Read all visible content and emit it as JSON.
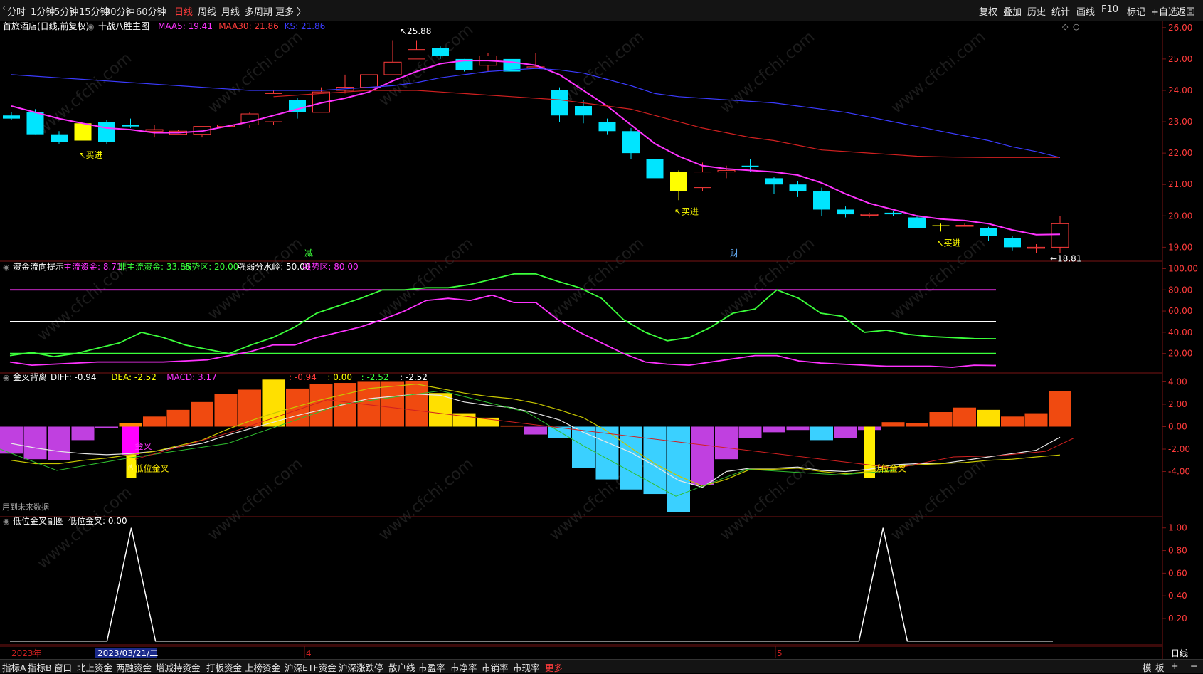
{
  "topbar": {
    "periods": [
      "分时",
      "1分钟",
      "5分钟",
      "15分钟",
      "30分钟",
      "60分钟",
      "日线",
      "周线",
      "月线",
      "多周期",
      "更多 〉"
    ],
    "active_period": "日线",
    "right_buttons": [
      "复权",
      "叠加",
      "历史",
      "统计",
      "画线",
      "F10",
      "标记",
      "+自选",
      "返回"
    ]
  },
  "main_panel": {
    "stock_label": "首旅酒店(日线,前复权)",
    "indicator_name": "十战八胜主图",
    "legend": [
      {
        "text": "MAA5: 19.41",
        "color": "#ff33ff"
      },
      {
        "text": "MAA30: 21.86",
        "color": "#ff3b3b"
      },
      {
        "text": "KS: 21.86",
        "color": "#3b3bff"
      }
    ],
    "y_ticks": [
      "26.00",
      "25.00",
      "24.00",
      "23.00",
      "22.00",
      "21.00",
      "20.00",
      "19.00"
    ],
    "y_range": [
      18.6,
      26.2
    ],
    "high_label": "25.88",
    "low_label": "←18.81",
    "buy_label": "↖买进",
    "markers": [
      {
        "text": "减",
        "color": "#3bff3b"
      },
      {
        "text": "财",
        "color": "#66b3ff"
      }
    ]
  },
  "flow_panel": {
    "title": "资金流向提示",
    "legend": [
      {
        "text": "主流资金: 8.71",
        "color": "#ff33ff"
      },
      {
        "text": "非主流资金: 33.85",
        "color": "#3bff3b"
      },
      {
        "text": "弱势区: 20.00",
        "color": "#3bff3b"
      },
      {
        "text": "强弱分水岭: 50.00",
        "color": "#ffffff"
      },
      {
        "text": "强势区: 80.00",
        "color": "#ff33ff"
      }
    ],
    "y_ticks": [
      "100.00",
      "80.00",
      "60.00",
      "40.00",
      "20.00"
    ],
    "y_range": [
      3,
      105
    ]
  },
  "macd_panel": {
    "title": "金叉背离",
    "legend": [
      {
        "text": "DIFF: -0.94",
        "color": "#ffffff"
      },
      {
        "text": "DEA: -2.52",
        "color": "#ffff00"
      },
      {
        "text": "MACD: 3.17",
        "color": "#ff33ff"
      }
    ],
    "legend2": [
      {
        "text": ": -0.94",
        "color": "#ff3b3b"
      },
      {
        "text": ": 0.00",
        "color": "#ffff00"
      },
      {
        "text": ": -2.52",
        "color": "#3bff3b"
      },
      {
        "text": ": -2.52",
        "color": "#ffffff"
      }
    ],
    "y_ticks": [
      "4.00",
      "2.00",
      "0.00",
      "-2.00",
      "-4.00"
    ],
    "y_range": [
      -7.9,
      4.6
    ],
    "cross_label": "低位金叉",
    "cross_label_purple": "金叉",
    "future_note": "用到未来数据"
  },
  "signal_panel": {
    "title": "低位金叉副图",
    "legend": [
      {
        "text": "低位金叉: 0.00",
        "color": "#ffffff"
      }
    ],
    "y_ticks": [
      "1.00",
      "0.80",
      "0.60",
      "0.40",
      "0.20"
    ],
    "y_range": [
      -0.02,
      1.08
    ]
  },
  "axis": {
    "year_label": "2023年",
    "date_tag": "2023/03/21/二",
    "month_labels": [
      "4",
      "5"
    ]
  },
  "statusbar": {
    "tabs": [
      "指标A",
      "指标B",
      "窗口",
      "北上资金",
      "两融资金",
      "增减持资金",
      "打板资金",
      "上榜资金",
      "沪深ETF资金",
      "沪深涨跌停",
      "散户线",
      "市盈率",
      "市净率",
      "市销率",
      "市现率",
      "更多"
    ],
    "right_tabs": [
      "模",
      "板"
    ],
    "period": "日线"
  },
  "watermark": "www.cfchi.com",
  "chart_data": [
    {
      "type": "candlestick",
      "title": "首旅酒店(日线,前复权)",
      "ohlc": [
        [
          23.2,
          23.3,
          23.05,
          23.1
        ],
        [
          23.3,
          23.4,
          22.6,
          22.6
        ],
        [
          22.6,
          22.7,
          22.3,
          22.35
        ],
        [
          22.4,
          23.0,
          22.3,
          22.95
        ],
        [
          23.0,
          23.05,
          22.3,
          22.35
        ],
        [
          22.9,
          23.1,
          22.8,
          22.85
        ],
        [
          22.7,
          22.9,
          22.5,
          22.75
        ],
        [
          22.6,
          22.75,
          22.6,
          22.7
        ],
        [
          22.6,
          22.85,
          22.5,
          22.85
        ],
        [
          22.85,
          23.0,
          22.7,
          22.9
        ],
        [
          22.9,
          23.3,
          22.8,
          23.25
        ],
        [
          23.0,
          24.0,
          22.9,
          23.9
        ],
        [
          23.7,
          23.75,
          23.1,
          23.3
        ],
        [
          23.3,
          24.1,
          23.3,
          23.95
        ],
        [
          24.0,
          24.5,
          23.9,
          24.1
        ],
        [
          24.1,
          24.9,
          24.1,
          24.5
        ],
        [
          24.5,
          25.6,
          24.5,
          24.9
        ],
        [
          25.0,
          25.6,
          25.0,
          25.3
        ],
        [
          25.35,
          25.4,
          25.0,
          25.1
        ],
        [
          25.0,
          25.0,
          24.6,
          24.65
        ],
        [
          24.8,
          25.2,
          24.6,
          25.1
        ],
        [
          25.0,
          25.1,
          24.55,
          24.6
        ],
        [
          24.75,
          25.2,
          24.7,
          24.75
        ],
        [
          24.0,
          24.1,
          23.0,
          23.2
        ],
        [
          23.5,
          23.7,
          22.95,
          23.2
        ],
        [
          23.0,
          23.1,
          22.6,
          22.7
        ],
        [
          22.7,
          22.8,
          21.8,
          22.0
        ],
        [
          21.8,
          21.9,
          21.2,
          21.2
        ],
        [
          21.4,
          21.45,
          20.5,
          20.8
        ],
        [
          20.9,
          21.7,
          20.8,
          21.4
        ],
        [
          21.4,
          21.6,
          21.2,
          21.45
        ],
        [
          21.6,
          21.8,
          21.4,
          21.55
        ],
        [
          21.2,
          21.25,
          20.7,
          21.0
        ],
        [
          21.0,
          21.1,
          20.6,
          20.8
        ],
        [
          20.8,
          20.9,
          20.0,
          20.2
        ],
        [
          20.2,
          20.3,
          19.95,
          20.05
        ],
        [
          20.05,
          20.1,
          19.95,
          20.05
        ],
        [
          20.1,
          20.15,
          20.0,
          20.05
        ],
        [
          19.95,
          20.0,
          19.6,
          19.6
        ],
        [
          19.7,
          19.75,
          19.5,
          19.7
        ],
        [
          19.7,
          19.75,
          19.7,
          19.7
        ],
        [
          19.6,
          19.65,
          19.2,
          19.35
        ],
        [
          19.3,
          19.35,
          18.9,
          19.0
        ],
        [
          19.0,
          19.1,
          18.81,
          19.0
        ],
        [
          19.0,
          20.0,
          18.81,
          19.75
        ]
      ],
      "series": [
        {
          "name": "MAA5",
          "values": [
            23.5,
            23.3,
            23.1,
            22.95,
            22.8,
            22.75,
            22.65,
            22.65,
            22.7,
            22.85,
            23.0,
            23.2,
            23.4,
            23.6,
            23.75,
            23.95,
            24.3,
            24.6,
            24.85,
            24.95,
            24.95,
            24.9,
            24.8,
            24.5,
            24.0,
            23.5,
            22.9,
            22.3,
            21.9,
            21.6,
            21.5,
            21.45,
            21.4,
            21.3,
            21.05,
            20.7,
            20.4,
            20.2,
            20.0,
            19.9,
            19.85,
            19.75,
            19.55,
            19.4,
            19.41
          ]
        },
        {
          "name": "MAA30",
          "values": [
            null,
            null,
            null,
            null,
            null,
            null,
            null,
            null,
            null,
            null,
            null,
            23.8,
            23.85,
            23.9,
            23.95,
            24.0,
            24.0,
            24.0,
            23.95,
            23.9,
            23.85,
            23.8,
            23.75,
            23.7,
            23.6,
            23.5,
            23.4,
            23.2,
            23.0,
            22.8,
            22.65,
            22.5,
            22.4,
            22.25,
            22.1,
            22.05,
            22.0,
            21.95,
            21.9,
            21.88,
            21.87,
            21.86,
            21.86,
            21.86,
            21.86
          ]
        },
        {
          "name": "KS",
          "values": [
            24.5,
            24.45,
            24.4,
            24.35,
            24.3,
            24.25,
            24.2,
            24.15,
            24.1,
            24.05,
            24.0,
            24.0,
            24.0,
            24.0,
            24.05,
            24.1,
            24.15,
            24.25,
            24.4,
            24.5,
            24.6,
            24.65,
            24.7,
            24.65,
            24.55,
            24.35,
            24.15,
            23.9,
            23.8,
            23.75,
            23.7,
            23.65,
            23.6,
            23.5,
            23.4,
            23.3,
            23.15,
            23.0,
            22.85,
            22.7,
            22.55,
            22.4,
            22.2,
            22.05,
            21.86
          ]
        }
      ]
    },
    {
      "type": "line",
      "title": "资金流向提示",
      "series": [
        {
          "name": "主流资金",
          "values": [
            12,
            9,
            10,
            11,
            12,
            12,
            12,
            12,
            13,
            14,
            18,
            22,
            28,
            28,
            35,
            40,
            45,
            52,
            60,
            70,
            72,
            70,
            75,
            68,
            68,
            52,
            40,
            30,
            20,
            12,
            10,
            9,
            12,
            15,
            18,
            18,
            13,
            11,
            10,
            9,
            8,
            8,
            8,
            7,
            9,
            8.71
          ]
        },
        {
          "name": "非主流资金",
          "values": [
            18,
            21,
            17,
            20,
            25,
            30,
            40,
            35,
            28,
            24,
            20,
            28,
            35,
            45,
            58,
            65,
            72,
            80,
            80,
            82,
            82,
            85,
            90,
            95,
            95,
            88,
            82,
            72,
            52,
            40,
            32,
            35,
            45,
            58,
            62,
            80,
            72,
            58,
            55,
            40,
            42,
            38,
            36,
            35,
            34,
            33.85
          ]
        }
      ],
      "levels": [
        {
          "name": "弱势区",
          "value": 20
        },
        {
          "name": "强弱分水岭",
          "value": 50
        },
        {
          "name": "强势区",
          "value": 80
        }
      ]
    },
    {
      "type": "bar",
      "title": "金叉背离",
      "series": [
        {
          "name": "MACD",
          "values": [
            -2.4,
            -2.9,
            -3.0,
            -1.2,
            -0.1,
            0.3,
            0.9,
            1.5,
            2.2,
            2.9,
            3.3,
            4.2,
            3.4,
            3.8,
            3.9,
            4.0,
            4.0,
            4.1,
            3.0,
            1.2,
            0.8,
            0.1,
            -0.7,
            -1.0,
            -3.7,
            -4.7,
            -5.6,
            -6.0,
            -7.6,
            -5.2,
            -2.9,
            -1.0,
            -0.5,
            -0.3,
            -1.2,
            -1.0,
            -0.3,
            0.4,
            0.3,
            1.3,
            1.7,
            1.5,
            0.9,
            1.2,
            3.17
          ]
        },
        {
          "name": "DIFF",
          "values": [
            -1.5,
            -1.9,
            -2.2,
            -2.4,
            -2.5,
            -2.4,
            -2.2,
            -1.8,
            -1.5,
            -0.8,
            -0.2,
            0.4,
            1.0,
            1.5,
            2.0,
            2.5,
            2.7,
            2.9,
            2.8,
            2.2,
            1.9,
            1.7,
            1.2,
            0.6,
            -0.5,
            -1.4,
            -2.3,
            -3.5,
            -4.8,
            -5.4,
            -4.0,
            -3.7,
            -3.7,
            -3.6,
            -3.9,
            -4.0,
            -3.8,
            -3.4,
            -3.3,
            -3.3,
            -3.0,
            -2.7,
            -2.4,
            -2.1,
            -0.94
          ]
        },
        {
          "name": "DEA",
          "values": [
            -3.0,
            -3.3,
            -3.3,
            -3.0,
            -2.8,
            -2.5,
            -2.2,
            -1.7,
            -1.2,
            -0.3,
            0.5,
            1.2,
            1.8,
            2.4,
            2.9,
            3.4,
            3.6,
            3.8,
            3.4,
            3.0,
            2.7,
            2.5,
            2.1,
            1.5,
            0.8,
            -0.4,
            -1.9,
            -3.3,
            -4.4,
            -5.3,
            -4.7,
            -3.8,
            -3.8,
            -3.7,
            -4.0,
            -4.2,
            -4.0,
            -3.6,
            -3.4,
            -3.3,
            -3.2,
            -3.0,
            -2.9,
            -2.7,
            -2.52
          ]
        }
      ]
    },
    {
      "type": "line",
      "title": "低位金叉副图",
      "series": [
        {
          "name": "低位金叉",
          "values": [
            0,
            0,
            0,
            0,
            0,
            1,
            0,
            0,
            0,
            0,
            0,
            0,
            0,
            0,
            0,
            0,
            0,
            0,
            0,
            0,
            0,
            0,
            0,
            0,
            0,
            0,
            0,
            0,
            0,
            0,
            0,
            0,
            0,
            0,
            0,
            0,
            1,
            0,
            0,
            0,
            0,
            0,
            0,
            0
          ]
        }
      ]
    }
  ]
}
